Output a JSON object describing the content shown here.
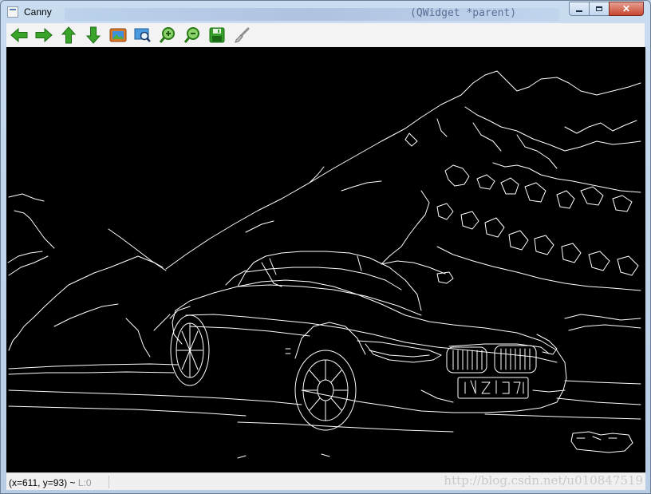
{
  "window": {
    "title": "Canny",
    "background_code_fragment": "(QWidget *parent)"
  },
  "caption_buttons": [
    "minimize",
    "maximize",
    "close"
  ],
  "toolbar": {
    "buttons": [
      {
        "icon": "arrow-left-icon",
        "label": "Pan left"
      },
      {
        "icon": "arrow-right-icon",
        "label": "Pan right"
      },
      {
        "icon": "arrow-up-icon",
        "label": "Pan up"
      },
      {
        "icon": "arrow-down-icon",
        "label": "Pan down"
      },
      {
        "icon": "image-icon",
        "label": "Image"
      },
      {
        "icon": "zoom-fit-icon",
        "label": "Zoom fit"
      },
      {
        "icon": "zoom-in-icon",
        "label": "Zoom in"
      },
      {
        "icon": "zoom-out-icon",
        "label": "Zoom out"
      },
      {
        "icon": "save-icon",
        "label": "Save"
      },
      {
        "icon": "brush-icon",
        "label": "Properties"
      }
    ]
  },
  "image": {
    "description": "Canny edge detection output of a sports car in front of mountains",
    "background": "#000000",
    "edge_color": "#ffffff"
  },
  "status": {
    "coords": "(x=611, y=93) ~ ",
    "level": "L:0",
    "watermark": "http://blog.csdn.net/u010847519"
  },
  "colors": {
    "accent_green": "#3aa329",
    "toolbar_bg": "#f3f3f3",
    "status_bg": "#f0f0f0"
  }
}
